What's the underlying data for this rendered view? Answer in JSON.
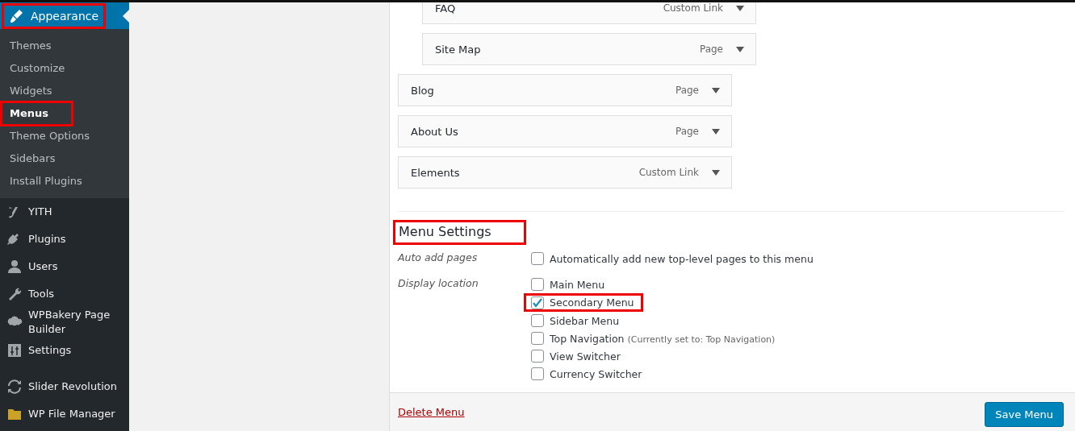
{
  "sidebar": {
    "current": {
      "label": "Appearance",
      "highlighted": true
    },
    "submenu": [
      {
        "label": "Themes",
        "selected": false,
        "highlighted": false
      },
      {
        "label": "Customize",
        "selected": false,
        "highlighted": false
      },
      {
        "label": "Widgets",
        "selected": false,
        "highlighted": false
      },
      {
        "label": "Menus",
        "selected": true,
        "highlighted": true
      },
      {
        "label": "Theme Options",
        "selected": false,
        "highlighted": false
      },
      {
        "label": "Sidebars",
        "selected": false,
        "highlighted": false
      },
      {
        "label": "Install Plugins",
        "selected": false,
        "highlighted": false
      }
    ],
    "items": [
      {
        "label": "YITH",
        "kind": "yith"
      },
      {
        "label": "Plugins",
        "kind": "plug"
      },
      {
        "label": "Users",
        "kind": "user"
      },
      {
        "label": "Tools",
        "kind": "wrench"
      },
      {
        "label": "WPBakery Page Builder",
        "kind": "cloud"
      },
      {
        "label": "Settings",
        "kind": "sliders"
      }
    ],
    "items_after_separator": [
      {
        "label": "Slider Revolution",
        "kind": "refresh"
      },
      {
        "label": "WP File Manager",
        "kind": "folder"
      }
    ]
  },
  "menu_items": [
    {
      "children": [
        {
          "title": "FAQ",
          "type": "Custom Link"
        },
        {
          "title": "Site Map",
          "type": "Page"
        }
      ]
    },
    {
      "title": "Blog",
      "type": "Page"
    },
    {
      "title": "About Us",
      "type": "Page"
    },
    {
      "title": "Elements",
      "type": "Custom Link"
    }
  ],
  "menu_settings": {
    "heading": "Menu Settings",
    "heading_highlighted": true,
    "auto_add": {
      "label": "Auto add pages",
      "option": {
        "label": "Automatically add new top-level pages to this menu",
        "checked": false
      }
    },
    "display_location": {
      "label": "Display location",
      "options": [
        {
          "label": "Main Menu",
          "checked": false,
          "highlighted": false
        },
        {
          "label": "Secondary Menu",
          "checked": true,
          "highlighted": true
        },
        {
          "label": "Sidebar Menu",
          "checked": false,
          "highlighted": false
        },
        {
          "label": "Top Navigation",
          "note": "(Currently set to: Top Navigation)",
          "checked": false,
          "highlighted": false
        },
        {
          "label": "View Switcher",
          "checked": false,
          "highlighted": false
        },
        {
          "label": "Currency Switcher",
          "checked": false,
          "highlighted": false
        }
      ]
    }
  },
  "footer": {
    "delete_link": "Delete Menu",
    "save_button": "Save Menu"
  }
}
